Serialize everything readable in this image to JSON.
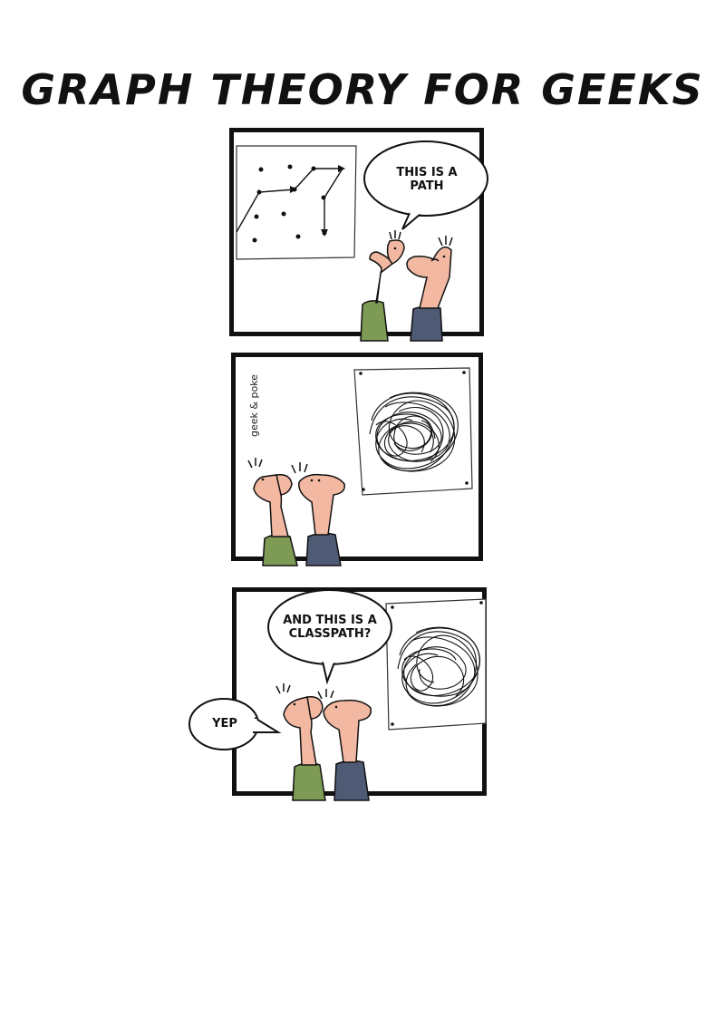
{
  "comic": {
    "title": "GRAPH THEORY FOR GEEKS",
    "credit": "geek & poke",
    "panels": [
      {
        "speech": "THIS IS A PATH"
      },
      {
        "speech": ""
      },
      {
        "speech": "AND THIS IS A CLASSPATH?",
        "reply": "YEP"
      }
    ]
  },
  "colors": {
    "skin": "#f3b8a2",
    "green_shirt": "#7e9b55",
    "blue_shirt": "#4f5a75",
    "ink": "#111111"
  },
  "icons": [
    "path-graph-poster-icon",
    "tangle-poster-icon",
    "geek-figure-icon"
  ]
}
